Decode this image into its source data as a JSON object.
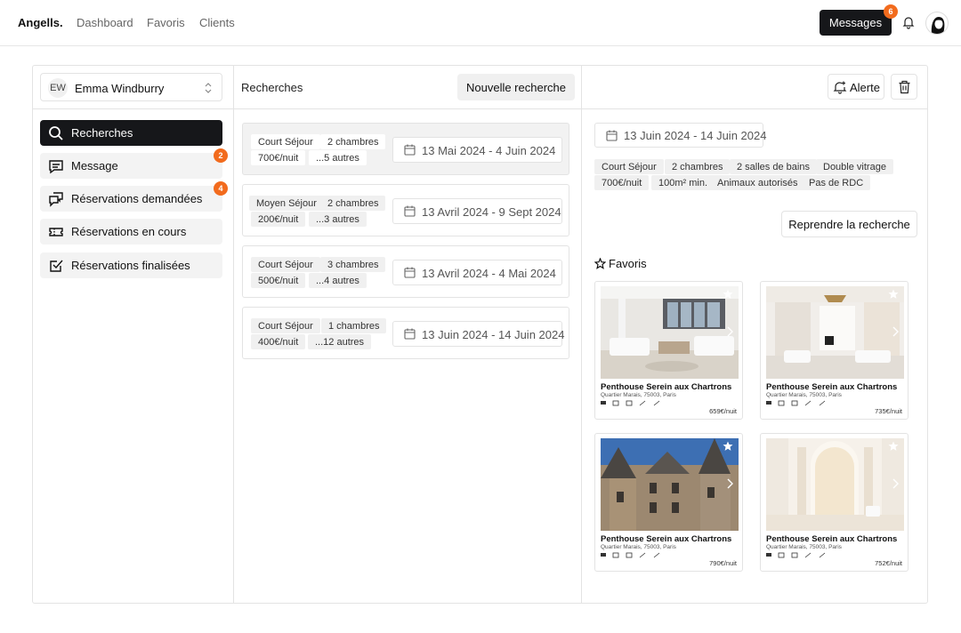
{
  "nav": {
    "brand": "Angells.",
    "links": [
      "Dashboard",
      "Favoris",
      "Clients"
    ],
    "messages_label": "Messages",
    "messages_count": "6"
  },
  "user": {
    "initials": "EW",
    "name": "Emma Windburry"
  },
  "sidebar": {
    "items": [
      {
        "label": "Recherches",
        "icon": "search-icon",
        "badge": ""
      },
      {
        "label": "Message",
        "icon": "message-icon",
        "badge": "2"
      },
      {
        "label": "Réservations demandées",
        "icon": "chat-bubbles-icon",
        "badge": "4"
      },
      {
        "label": "Réservations en cours",
        "icon": "ticket-icon",
        "badge": ""
      },
      {
        "label": "Réservations finalisées",
        "icon": "checkbox-icon",
        "badge": ""
      }
    ]
  },
  "searches": {
    "title": "Recherches",
    "new_label": "Nouvelle recherche",
    "items": [
      {
        "duration": "Court Séjour",
        "rooms": "2 chambres",
        "price": "700€/nuit",
        "more": "...5 autres",
        "dates": "13 Mai 2024 - 4 Juin 2024"
      },
      {
        "duration": "Moyen Séjour",
        "rooms": "2 chambres",
        "price": "200€/nuit",
        "more": "...3 autres",
        "dates": "13 Avril 2024 - 9 Sept 2024"
      },
      {
        "duration": "Court Séjour",
        "rooms": "3 chambres",
        "price": "500€/nuit",
        "more": "...4 autres",
        "dates": "13 Avril 2024 - 4 Mai 2024"
      },
      {
        "duration": "Court Séjour",
        "rooms": "1 chambres",
        "price": "400€/nuit",
        "more": "...12 autres",
        "dates": "13 Juin 2024 - 14 Juin 2024"
      }
    ]
  },
  "detail": {
    "alert_label": "Alerte",
    "dates": "13 Juin 2024 - 14 Juin 2024",
    "criteria": [
      "Court Séjour",
      "2 chambres",
      "2 salles de bains",
      "Double vitrage",
      "700€/nuit",
      "100m² min.",
      "Animaux autorisés",
      "Pas de RDC"
    ],
    "resume_label": "Reprendre la recherche",
    "favorites_title": "Favoris",
    "favorites": [
      {
        "name": "Penthouse Serein aux Chartrons",
        "address": "Quartier Marais, 75003, Paris",
        "price": "659€/nuit",
        "starred": false
      },
      {
        "name": "Penthouse Serein aux Chartrons",
        "address": "Quartier Marais, 75003, Paris",
        "price": "735€/nuit",
        "starred": false
      },
      {
        "name": "Penthouse Serein aux Chartrons",
        "address": "Quartier Marais, 75003, Paris",
        "price": "790€/nuit",
        "starred": true
      },
      {
        "name": "Penthouse Serein aux Chartrons",
        "address": "Quartier Marais, 75003, Paris",
        "price": "752€/nuit",
        "starred": false
      }
    ]
  },
  "colors": {
    "accent_dark": "#16171a",
    "badge_orange": "#f26b1d",
    "starred_blue": "#2f6fd6"
  }
}
